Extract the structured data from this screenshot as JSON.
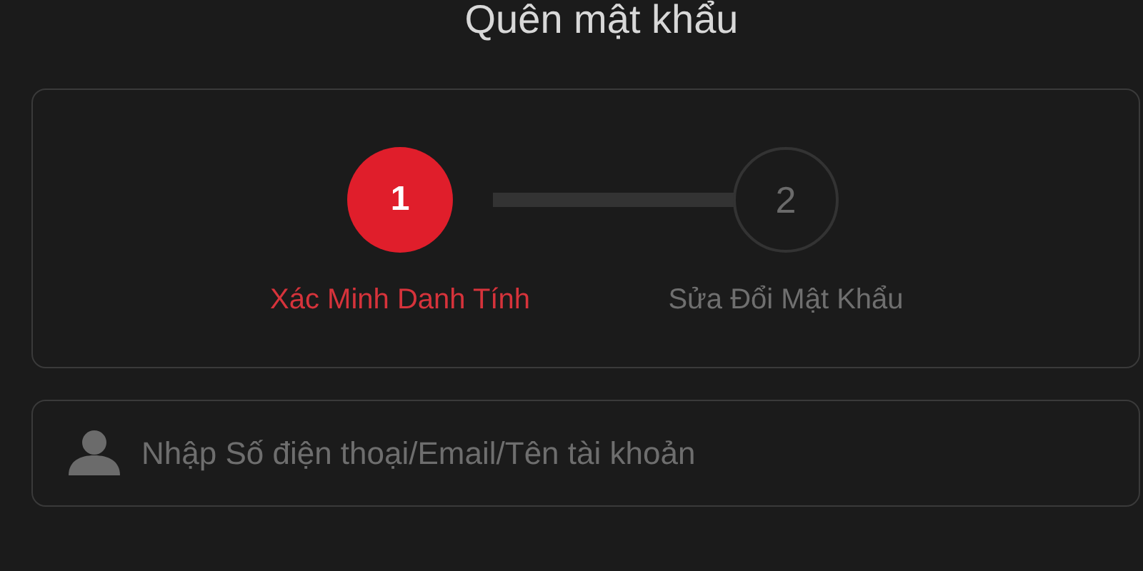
{
  "title": "Quên mật khẩu",
  "steps": [
    {
      "number": "1",
      "label": "Xác Minh Danh Tính",
      "selected": true
    },
    {
      "number": "2",
      "label": "Sửa Đổi Mật Khẩu",
      "selected": false
    }
  ],
  "account_field": {
    "placeholder": "Nhập Số điện thoại/Email/Tên tài khoản"
  }
}
